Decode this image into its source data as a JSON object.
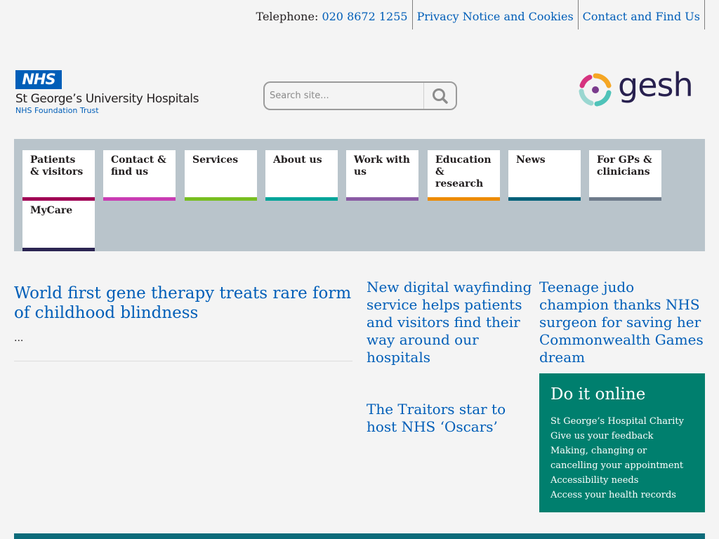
{
  "topbar": {
    "telephone_label": "Telephone:",
    "telephone_number": "020 8672 1255",
    "privacy_link": "Privacy Notice and Cookies",
    "contact_link": "Contact and Find Us"
  },
  "logo": {
    "nhs": "NHS",
    "org_name": "St George’s University Hospitals",
    "org_sub": "NHS Foundation Trust"
  },
  "search": {
    "placeholder": "Search site...",
    "icon": "search-icon"
  },
  "partner_logo": {
    "word": "gesh"
  },
  "nav": {
    "items": [
      {
        "label": "Patients & visitors",
        "color": "#a00054"
      },
      {
        "label": "Contact & find us",
        "color": "#c93cb3"
      },
      {
        "label": "Services",
        "color": "#78be20"
      },
      {
        "label": "About us",
        "color": "#00a499"
      },
      {
        "label": "Work with us",
        "color": "#8a5ba4"
      },
      {
        "label": "Education & research",
        "color": "#ed8b00"
      },
      {
        "label": "News",
        "color": "#006079"
      },
      {
        "label": "For GPs & clinicians",
        "color": "#6e7b8b"
      },
      {
        "label": "MyCare",
        "color": "#2b2552"
      }
    ]
  },
  "feature": {
    "title": "World first gene therapy treats rare form of childhood blindness",
    "excerpt": "..."
  },
  "stories": [
    "New digital wayfinding service helps patients and visitors find their way around our hospitals",
    "Teenage judo champion thanks NHS surgeon for saving her Commonwealth Games dream",
    "The Traitors star to host NHS ‘Oscars’"
  ],
  "online": {
    "title": "Do it online",
    "links": [
      "St George’s Hospital Charity",
      "Give us your feedback",
      "Making, changing or cancelling your appointment",
      "Accessibility needs",
      "Access your health records"
    ]
  },
  "colors": {
    "nhs_blue": "#005eb8",
    "nav_bg": "#b9c4cb",
    "online_bg": "#007f6e"
  }
}
